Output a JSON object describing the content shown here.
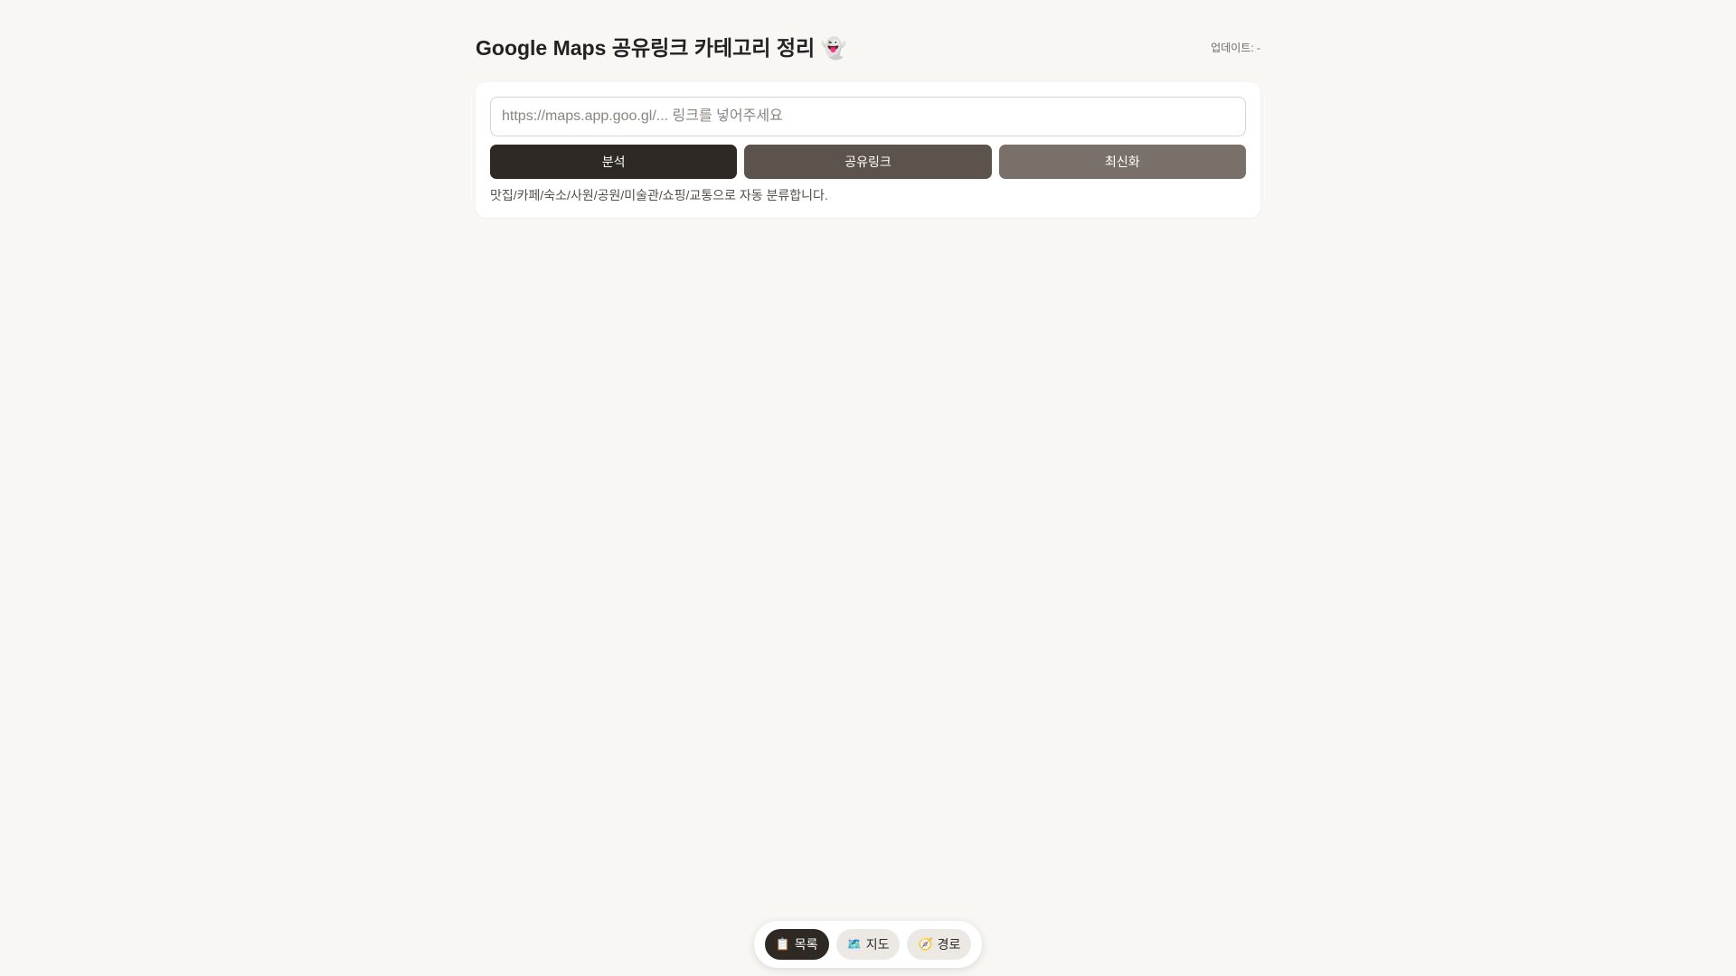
{
  "header": {
    "title": "Google Maps 공유링크 카테고리 정리 👻",
    "updated": "업데이트: -"
  },
  "input": {
    "placeholder": "https://maps.app.goo.gl/... 링크를 넣어주세요",
    "value": ""
  },
  "buttons": {
    "analyze": "분석",
    "share": "공유링크",
    "refresh": "최신화"
  },
  "help_text": "맛집/카페/숙소/사원/공원/미술관/쇼핑/교통으로 자동 분류합니다.",
  "bottom_nav": [
    {
      "icon": "📋",
      "label": "목록",
      "active": true
    },
    {
      "icon": "🗺️",
      "label": "지도",
      "active": false
    },
    {
      "icon": "🧭",
      "label": "경로",
      "active": false
    }
  ],
  "colors": {
    "background": "#f8f7f4",
    "analyze_button": "#2e2925",
    "share_button": "#5c534d",
    "refresh_button": "#7a706a"
  }
}
